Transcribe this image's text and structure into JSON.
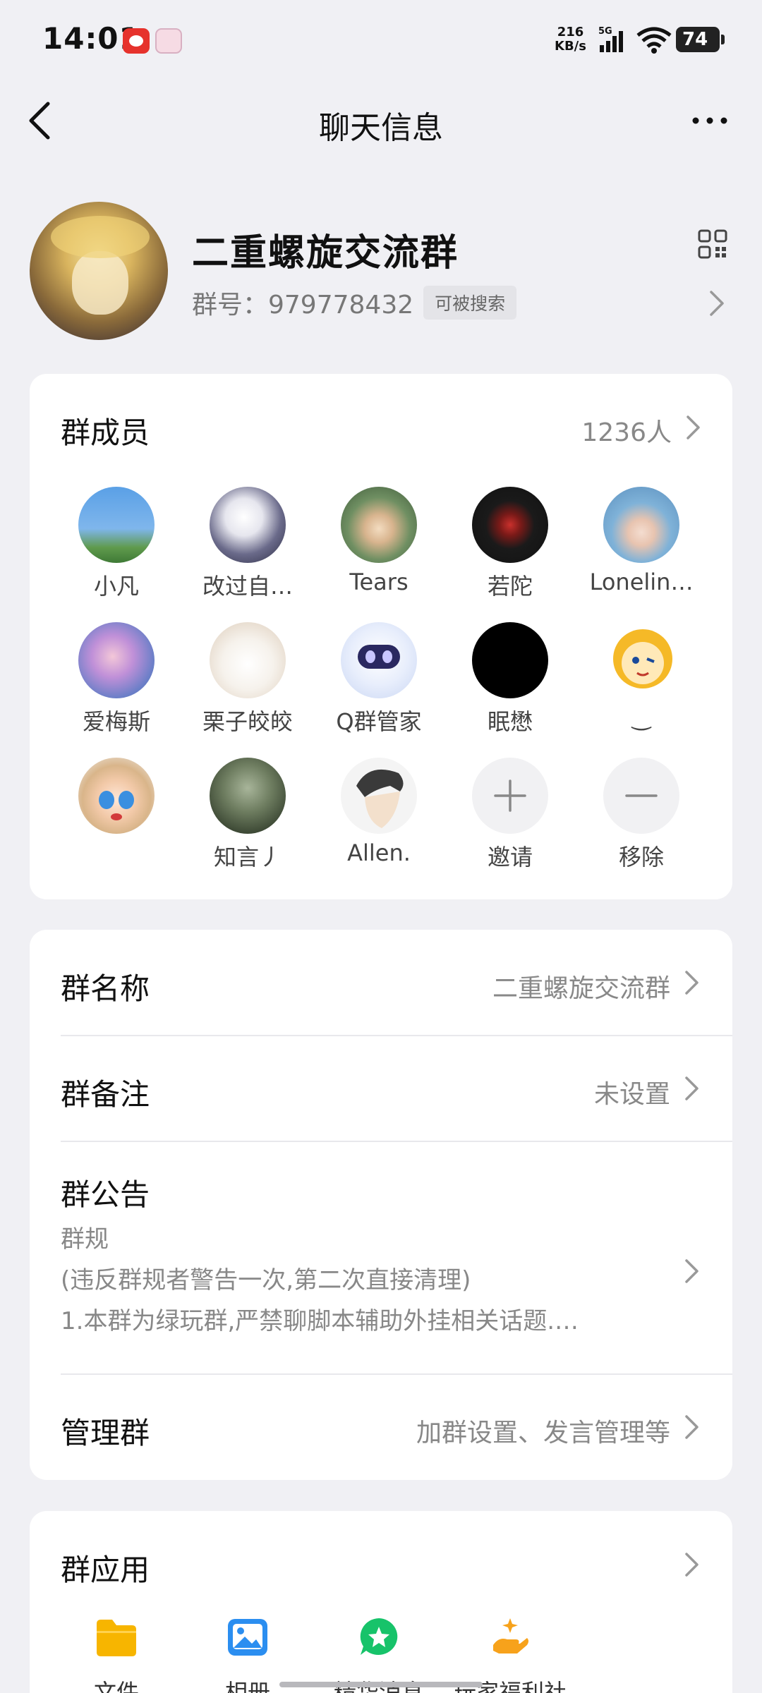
{
  "status_bar": {
    "time": "14:01",
    "net_speed_value": "216",
    "net_speed_unit": "KB/s",
    "network": "5G",
    "battery": "74"
  },
  "header": {
    "title": "聊天信息"
  },
  "group": {
    "name": "二重螺旋交流群",
    "id_text": "群号：979778432",
    "searchable_badge": "可被搜索"
  },
  "members": {
    "title": "群成员",
    "count": "1236人",
    "list": [
      {
        "name": "小凡",
        "color": "#4f8fd8"
      },
      {
        "name": "改过自…",
        "color": "#3b3c56"
      },
      {
        "name": "Tears",
        "color": "#6b8a62"
      },
      {
        "name": "若陀",
        "color": "#1a1a1a"
      },
      {
        "name": "Lonelin…",
        "color": "#9cc4e2"
      },
      {
        "name": "爱梅斯",
        "color": "#8d7fc7"
      },
      {
        "name": "栗子皎皎",
        "color": "#f3efe8"
      },
      {
        "name": "Q群管家",
        "color": "#dde6f8"
      },
      {
        "name": "眠懋",
        "color": "#000000"
      },
      {
        "name": "͜",
        "color": "#f5b927"
      },
      {
        "name": "",
        "color": "#f0c9a6"
      },
      {
        "name": "知言丿",
        "color": "#4a5a44"
      },
      {
        "name": "Allen.",
        "color": "#f2f2f2"
      }
    ],
    "invite_label": "邀请",
    "remove_label": "移除"
  },
  "settings": {
    "group_name_label": "群名称",
    "group_name_value": "二重螺旋交流群",
    "group_remark_label": "群备注",
    "group_remark_value": "未设置",
    "notice_label": "群公告",
    "notice_line1": "群规",
    "notice_line2": "(违反群规者警告一次,第二次直接清理)",
    "notice_line3": "1.本群为绿玩群,严禁聊脚本辅助外挂相关话题.…",
    "manage_label": "管理群",
    "manage_value": "加群设置、发言管理等"
  },
  "apps": {
    "title": "群应用",
    "items": [
      {
        "label": "文件",
        "icon": "folder-icon",
        "color": "#f7b500"
      },
      {
        "label": "相册",
        "icon": "album-icon",
        "color": "#2b8ef0"
      },
      {
        "label": "精华消息",
        "icon": "star-chat-icon",
        "color": "#17c36a"
      },
      {
        "label": "玩家福利社",
        "icon": "gift-hand-icon",
        "color": "#f7a21b"
      }
    ]
  }
}
